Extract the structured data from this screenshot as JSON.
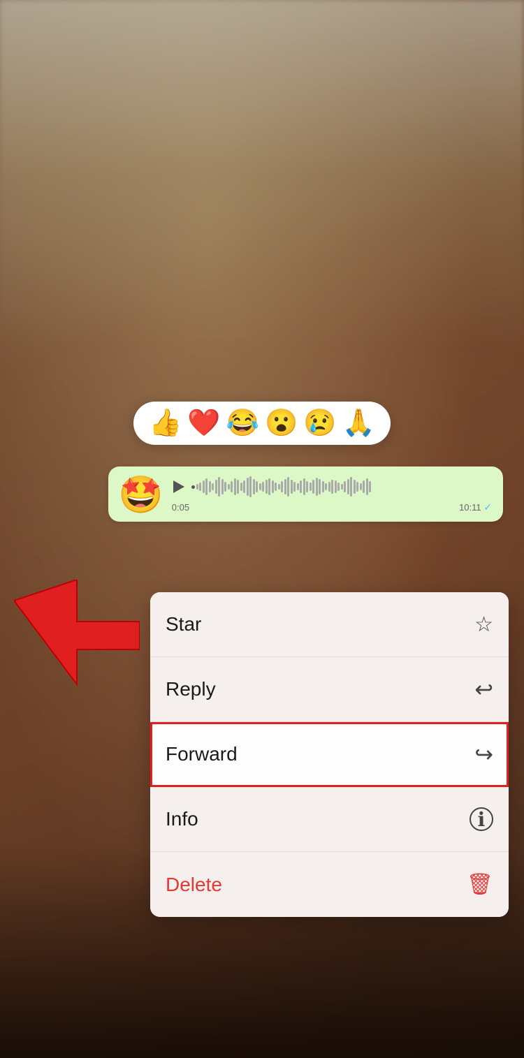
{
  "background": {
    "description": "blurred warm brown indoor background"
  },
  "emoji_bar": {
    "emojis": [
      "👍",
      "❤️",
      "😂",
      "😮",
      "😢",
      "🙏"
    ]
  },
  "message_bubble": {
    "avatar_emoji": "🤩",
    "time_start": "0:05",
    "time_end": "10:11"
  },
  "context_menu": {
    "items": [
      {
        "id": "star",
        "label": "Star",
        "icon": "☆",
        "highlighted": false,
        "delete": false
      },
      {
        "id": "reply",
        "label": "Reply",
        "icon": "↩",
        "highlighted": false,
        "delete": false
      },
      {
        "id": "forward",
        "label": "Forward",
        "icon": "↪",
        "highlighted": true,
        "delete": false
      },
      {
        "id": "info",
        "label": "Info",
        "icon": "ℹ",
        "highlighted": false,
        "delete": false
      },
      {
        "id": "delete",
        "label": "Delete",
        "icon": "🗑",
        "highlighted": false,
        "delete": true
      }
    ]
  }
}
